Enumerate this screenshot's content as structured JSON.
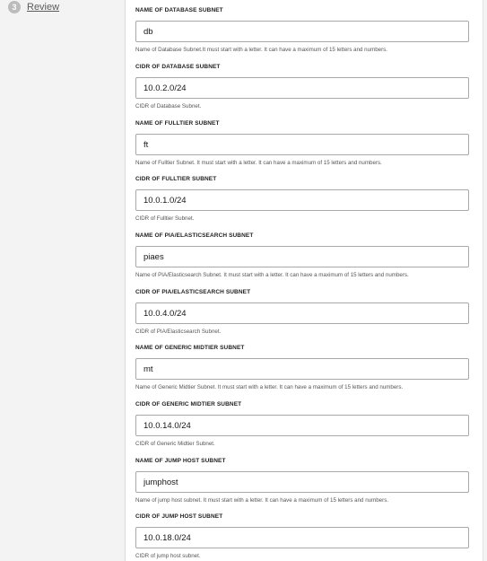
{
  "wizard": {
    "step": {
      "number": "3",
      "label": "Review"
    }
  },
  "fields": [
    {
      "label": "NAME OF DATABASE SUBNET",
      "value": "db",
      "help": "Name of Database Subnet.It must start with a letter. It can have a maximum of 15 letters and numbers."
    },
    {
      "label": "CIDR OF DATABASE SUBNET",
      "value": "10.0.2.0/24",
      "help": "CIDR of Database Subnet."
    },
    {
      "label": "NAME OF FULLTIER SUBNET",
      "value": "ft",
      "help": "Name of Fulltier Subnet. It must start with a letter. It can have a maximum of 15 letters and numbers."
    },
    {
      "label": "CIDR OF FULLTIER SUBNET",
      "value": "10.0.1.0/24",
      "help": "CIDR of Fulltier Subnet."
    },
    {
      "label": "NAME OF PIA/ELASTICSEARCH SUBNET",
      "value": "piaes",
      "help": "Name of PIA/Elasticsearch Subnet. It must start with a letter. It can have a maximum of 15 letters and numbers."
    },
    {
      "label": "CIDR OF PIA/ELASTICSEARCH SUBNET",
      "value": "10.0.4.0/24",
      "help": "CIDR of PIA/Elasticsearch Subnet."
    },
    {
      "label": "NAME OF GENERIC MIDTIER SUBNET",
      "value": "mt",
      "help": "Name of Generic Midtier Subnet. It must start with a letter. It can have a maximum of 15 letters and numbers."
    },
    {
      "label": "CIDR OF GENERIC MIDTIER SUBNET",
      "value": "10.0.14.0/24",
      "help": "CIDR of Generic Midtier Subnet."
    },
    {
      "label": "NAME OF JUMP HOST SUBNET",
      "value": "jumphost",
      "help": "Name of jump host subnet. It must start with a letter. It can have a maximum of 15 letters and numbers."
    },
    {
      "label": "CIDR OF JUMP HOST SUBNET",
      "value": "10.0.18.0/24",
      "help": "CIDR of jump host subnet."
    }
  ]
}
